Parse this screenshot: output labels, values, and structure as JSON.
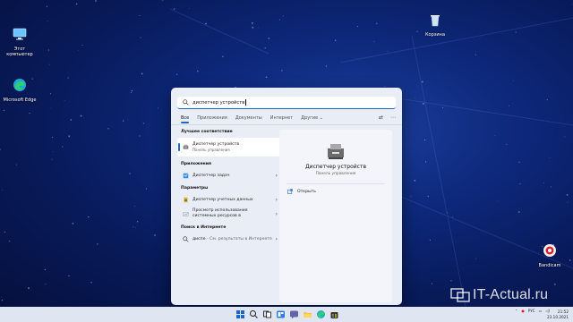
{
  "desktop": {
    "icons": [
      {
        "label": "Этот компьютер"
      },
      {
        "label": "Microsoft Edge"
      },
      {
        "label": "Корзина"
      },
      {
        "label": "Bandicam"
      }
    ]
  },
  "search": {
    "query": "диспетчер устройств",
    "icon": "search-icon"
  },
  "filters": {
    "all": "Все",
    "apps": "Приложения",
    "documents": "Документы",
    "internet": "Интернет",
    "more": "Другие ⌄"
  },
  "results": {
    "best_heading": "Лучшее соответствие",
    "best": {
      "title": "Диспетчер устройств",
      "subtitle": "Панель управления"
    },
    "apps_heading": "Приложения",
    "apps": [
      {
        "title": "Диспетчер задач"
      }
    ],
    "settings_heading": "Параметры",
    "settings": [
      {
        "title": "Диспетчер учетных данных"
      },
      {
        "title": "Просмотр использования системных ресурсов в"
      }
    ],
    "web_heading": "Поиск в Интернете",
    "web": [
      {
        "title": "диспе",
        "hint": " - См. результаты в Интернете"
      }
    ]
  },
  "detail": {
    "title": "Диспетчер устройств",
    "subtitle": "Панель управления",
    "open_label": "Открыть"
  },
  "watermark": {
    "text": "IT-Actual.ru"
  },
  "tray": {
    "lang": "РУС",
    "time": "21:52",
    "date": "23.10.2021"
  },
  "colors": {
    "accent": "#1a66c9",
    "wallpaper": "#0e2a7e",
    "taskbar": "#dfe6f2"
  }
}
